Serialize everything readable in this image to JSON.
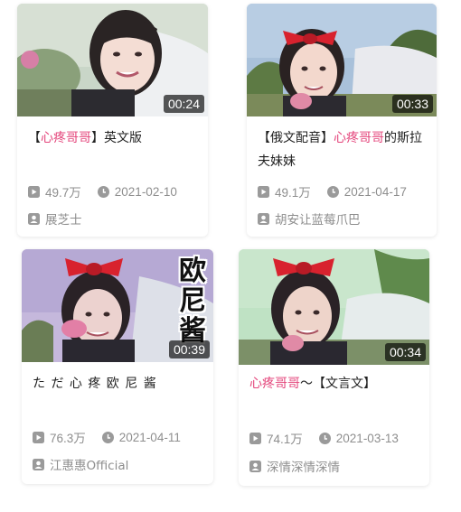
{
  "videos": [
    {
      "title_pre": "【",
      "title_hl": "心疼哥哥",
      "title_post": "】英文版",
      "duration": "00:24",
      "plays": "49.7万",
      "date": "2021-02-10",
      "author": "展芝士"
    },
    {
      "title_pre": "【俄文配音】",
      "title_hl": "心疼哥哥",
      "title_post": "的斯拉夫妹妹",
      "duration": "00:33",
      "plays": "49.1万",
      "date": "2021-04-17",
      "author": "胡安让蓝莓爪巴"
    },
    {
      "title_pre": "た だ 心 疼 欧 尼 酱",
      "title_hl": "",
      "title_post": "",
      "duration": "00:39",
      "plays": "76.3万",
      "date": "2021-04-11",
      "author": "江惠惠Official",
      "overlay": [
        "欧",
        "尼",
        "酱"
      ]
    },
    {
      "title_pre": "",
      "title_hl": "心疼哥哥",
      "title_post": "～【文言文】",
      "duration": "00:34",
      "plays": "74.1万",
      "date": "2021-03-13",
      "author": "深情深情深情"
    }
  ],
  "icons": {
    "plays": "play-count-icon",
    "date": "clock-icon",
    "author": "uploader-icon"
  },
  "colors": {
    "highlight": "#e4467c",
    "meta": "#8e8e8e",
    "bow": "#d8222e"
  }
}
